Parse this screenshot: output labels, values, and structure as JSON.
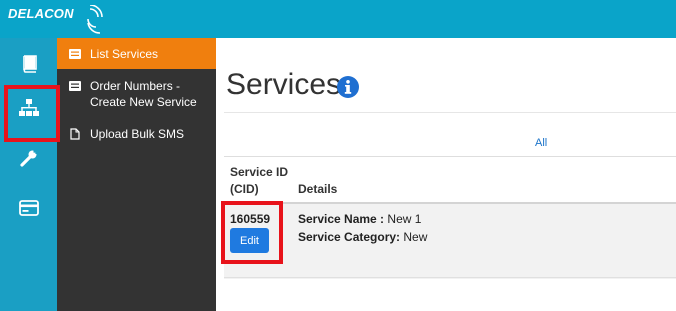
{
  "brand": {
    "name": "DELACON"
  },
  "rail": {
    "items": [
      {
        "icon": "book-icon"
      },
      {
        "icon": "org-chart-icon"
      },
      {
        "icon": "wrench-icon"
      },
      {
        "icon": "credit-card-icon"
      }
    ]
  },
  "submenu": {
    "items": [
      {
        "label": "List Services",
        "icon": "list-icon"
      },
      {
        "label": "Order Numbers - Create New Service",
        "icon": "list-icon"
      },
      {
        "label": "Upload Bulk SMS",
        "icon": "file-icon"
      }
    ]
  },
  "main": {
    "title": "Services",
    "filter_all": "All",
    "table": {
      "headers": {
        "service_id": "Service ID (CID)",
        "details": "Details"
      },
      "rows": [
        {
          "service_id": "160559",
          "edit_label": "Edit",
          "service_name_label": "Service Name :",
          "service_name": "New 1",
          "service_category_label": "Service Category:",
          "service_category": "New"
        }
      ]
    }
  },
  "colors": {
    "topbar": "#0aa4c9",
    "rail": "#1a9fc4",
    "submenu_bg": "#333333",
    "active_item": "#f07f0e",
    "edit_button": "#1f7ae0",
    "highlight": "#e8131b"
  }
}
